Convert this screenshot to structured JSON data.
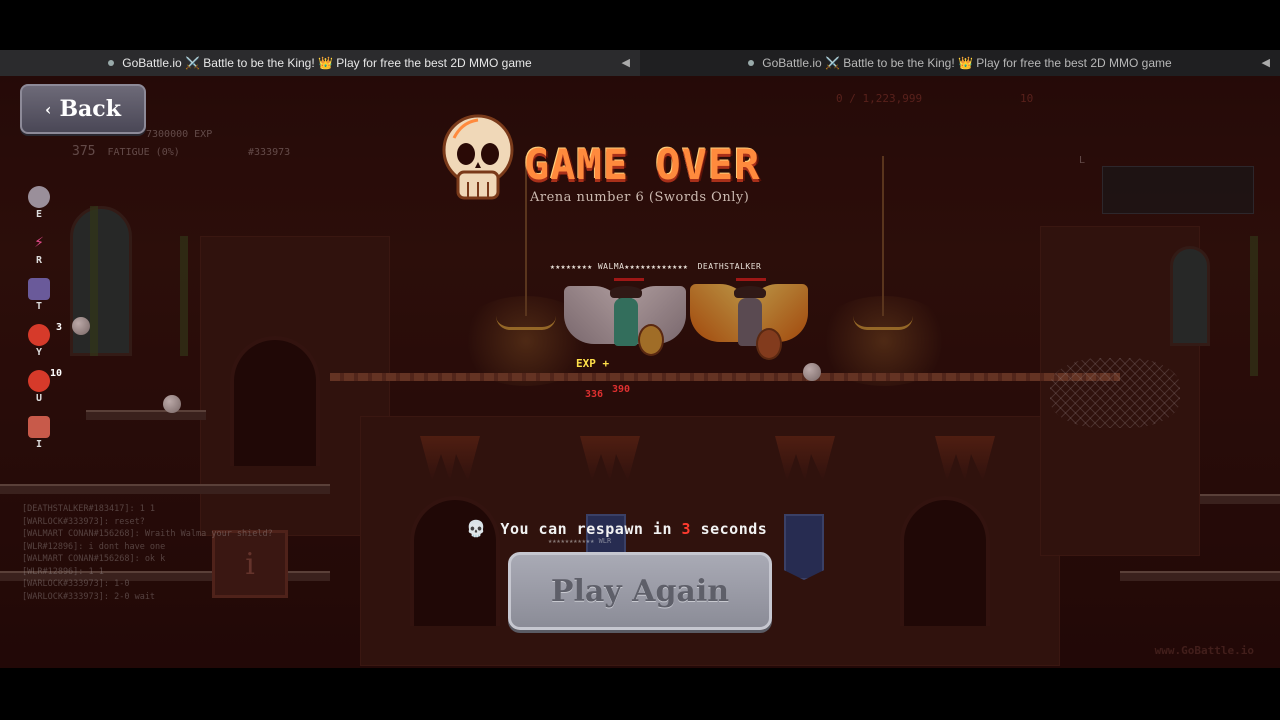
{
  "browser": {
    "tabs": [
      {
        "title": "GoBattle.io ⚔️ Battle to be the King! 👑 Play for free the best 2D MMO game",
        "active": true
      },
      {
        "title": "GoBattle.io ⚔️ Battle to be the King! 👑 Play for free the best 2D MMO game",
        "active": false
      }
    ]
  },
  "game": {
    "back_label": "Back",
    "hud_faded": {
      "level": "375",
      "exp": "7300000 EXP",
      "fatigue": "FATIGUE (0%)",
      "player_id": "#333973",
      "gold": "0 / 1,223,999",
      "gems": "10"
    },
    "skills": [
      {
        "key": "E",
        "icon": "skull-orb-icon",
        "count": ""
      },
      {
        "key": "R",
        "icon": "magic-wand-icon",
        "count": ""
      },
      {
        "key": "T",
        "icon": "bird-icon",
        "count": ""
      },
      {
        "key": "Y",
        "icon": "apple-icon",
        "count": "3"
      },
      {
        "key": "U",
        "icon": "apple-icon",
        "count": "10"
      },
      {
        "key": "I",
        "icon": "meat-icon",
        "count": ""
      }
    ],
    "game_over": {
      "title": "GAME OVER",
      "arena": "Arena number 6 (Swords Only)"
    },
    "players": {
      "left_name": "★★★★★★★★ WALMA★★★★★★★★★★★★",
      "right_name": "DEATHSTALKER",
      "exp_label": "EXP +",
      "damage_1": "336",
      "damage_2": "390"
    },
    "respawn": {
      "prefix": "You can respawn in",
      "seconds": "3",
      "suffix": "seconds",
      "tag": "★★★★★★★★★★★ WLR"
    },
    "play_again_label": "Play Again",
    "chat": [
      "[DEATHSTALKER#183417]: 1 1",
      "[WARLOCK#333973]: reset?",
      "[WALMART CONAN#156268]: Wraith Walma your shield?",
      "[WLR#12896]: i dont have one",
      "[WALMART CONAN#156268]: ok k",
      "[WLR#12896]: 1 1",
      "[WARLOCK#333973]: 1-0",
      "[WARLOCK#333973]: 2-0 wait"
    ],
    "watermark": "www.GoBattle.io",
    "minimap_label": "L"
  },
  "colors": {
    "title_orange": "#ff8a3d",
    "respawn_red": "#ff3b2f",
    "button_gray": "#a9aab5"
  }
}
